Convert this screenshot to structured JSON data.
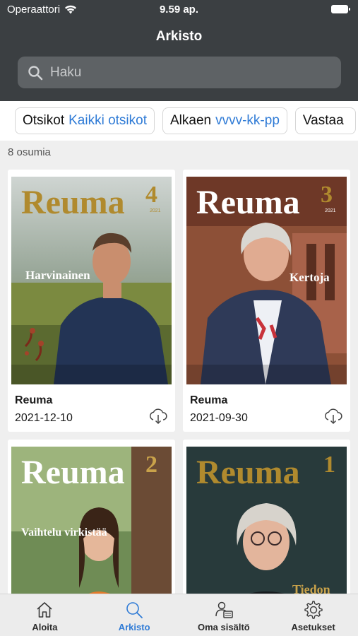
{
  "status": {
    "carrier": "Operaattori",
    "time": "9.59 ap."
  },
  "header": {
    "title": "Arkisto"
  },
  "search": {
    "placeholder": "Haku"
  },
  "filters": [
    {
      "label": "Otsikot",
      "value": "Kaikki otsikot"
    },
    {
      "label": "Alkaen",
      "value": "vvvv-kk-pp"
    },
    {
      "label": "Vastaa",
      "value": ""
    }
  ],
  "results": {
    "count_text": "8 osumia"
  },
  "issues": [
    {
      "name": "Reuma",
      "date": "2021-12-10",
      "cover_title": "Reuma",
      "issue_no": "4",
      "year": "2021",
      "headline": "Harvinainen",
      "bottom_headline": "",
      "masthead_color": "#b08a2e"
    },
    {
      "name": "Reuma",
      "date": "2021-09-30",
      "cover_title": "Reuma",
      "issue_no": "3",
      "year": "2021",
      "headline": "Kertoja",
      "bottom_headline": "",
      "masthead_color": "#ffffff"
    },
    {
      "name": "",
      "date": "",
      "cover_title": "Reuma",
      "issue_no": "2",
      "year": "",
      "headline": "Vaihtelu virkistää",
      "bottom_headline": "",
      "masthead_color": "#ffffff"
    },
    {
      "name": "",
      "date": "",
      "cover_title": "Reuma",
      "issue_no": "1",
      "year": "",
      "headline": "",
      "bottom_headline": "Tiedon",
      "masthead_color": "#b08a2e"
    }
  ],
  "tabs": [
    {
      "label": "Aloita",
      "icon": "home-icon"
    },
    {
      "label": "Arkisto",
      "icon": "search-icon"
    },
    {
      "label": "Oma sisältö",
      "icon": "user-content-icon"
    },
    {
      "label": "Asetukset",
      "icon": "gear-icon"
    }
  ],
  "colors": {
    "accent": "#2f7bd6",
    "header": "#3b3f42"
  }
}
